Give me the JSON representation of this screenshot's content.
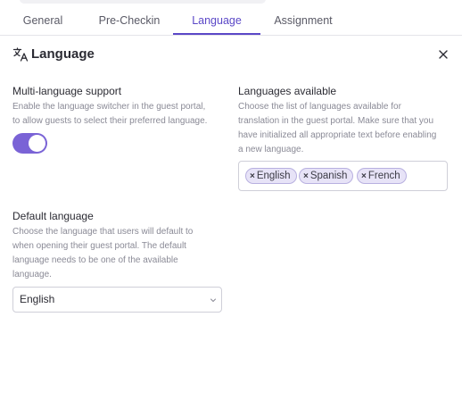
{
  "tabs": [
    {
      "label": "General",
      "active": false
    },
    {
      "label": "Pre-Checkin",
      "active": false
    },
    {
      "label": "Language",
      "active": true
    },
    {
      "label": "Assignment",
      "active": false
    }
  ],
  "header": {
    "title": "Language",
    "icon": "translate-icon",
    "close_icon": "close-icon"
  },
  "multi_language": {
    "title": "Multi-language support",
    "desc_lines": [
      "Enable the language switcher in the guest portal,",
      "to allow guests to select their preferred language."
    ],
    "enabled": true
  },
  "languages_available": {
    "title": "Languages available",
    "desc_lines": [
      "Choose the list of languages available for",
      "translation in the guest portal. Make sure that you",
      "have initialized all appropriate text before enabling",
      "a new language."
    ],
    "tags": [
      "English",
      "Spanish",
      "French"
    ],
    "remove_glyph": "×"
  },
  "default_language": {
    "title": "Default language",
    "desc_lines": [
      "Choose the language that users will default to",
      "when opening their guest portal. The default",
      "language needs to be one of the available",
      "language."
    ],
    "selected": "English"
  },
  "colors": {
    "accent": "#5b48c7",
    "toggle_on": "#7a63d6",
    "tag_bg": "#e7e3f7"
  }
}
